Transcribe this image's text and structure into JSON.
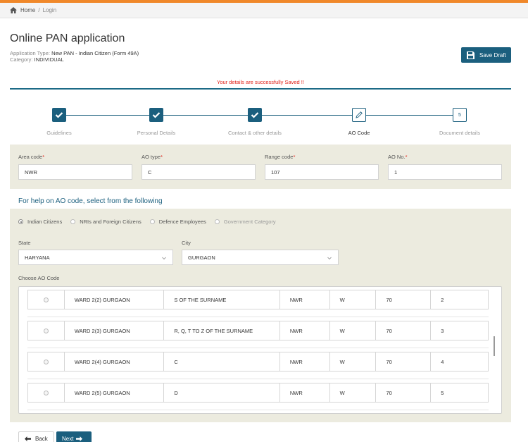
{
  "breadcrumb": {
    "home": "Home",
    "separator": "/",
    "current": "Login"
  },
  "header": {
    "title": "Online PAN application",
    "app_type_label": "Application Type:",
    "app_type_value": "New PAN - Indian Citizen (Form 49A)",
    "category_label": "Category:",
    "category_value": "INDIVIDUAL",
    "save_draft": "Save Draft"
  },
  "message": "Your details are successfully Saved !!",
  "steps": [
    {
      "label": "Guidelines",
      "state": "done"
    },
    {
      "label": "Personal Details",
      "state": "done"
    },
    {
      "label": "Contact & other details",
      "state": "done"
    },
    {
      "label": "AO Code",
      "state": "active"
    },
    {
      "label": "Document details",
      "state": "todo",
      "number": "5"
    }
  ],
  "ao_fields": {
    "area_code": {
      "label": "Area code",
      "value": "NWR"
    },
    "ao_type": {
      "label": "AO type",
      "value": "C"
    },
    "range_code": {
      "label": "Range code",
      "value": "107"
    },
    "ao_no": {
      "label": "AO No.",
      "value": "1"
    },
    "required_mark": "*"
  },
  "help": {
    "title": "For help on AO code, select from the following",
    "options": [
      {
        "label": "Indian Citizens",
        "selected": true
      },
      {
        "label": "NRIs and Foreign Citizens",
        "selected": false
      },
      {
        "label": "Defence Employees",
        "selected": false
      },
      {
        "label": "Government Category",
        "selected": false
      }
    ],
    "state_label": "State",
    "state_value": "HARYANA",
    "city_label": "City",
    "city_value": "GURGAON",
    "choose_label": "Choose AO Code"
  },
  "ao_rows": [
    [
      "WARD 2(2) GURGAON",
      "S OF THE SURNAME",
      "NWR",
      "W",
      "70",
      "2"
    ],
    [
      "WARD 2(3) GURGAON",
      "R, Q, T TO Z OF THE SURNAME",
      "NWR",
      "W",
      "70",
      "3"
    ],
    [
      "WARD 2(4) GURGAON",
      "C",
      "NWR",
      "W",
      "70",
      "4"
    ],
    [
      "WARD 2(5) GURGAON",
      "D",
      "NWR",
      "W",
      "70",
      "5"
    ]
  ],
  "nav": {
    "back": "Back",
    "next": "Next"
  },
  "colors": {
    "accent": "#1b5f7e",
    "top_bar": "#f0882a",
    "panel": "#ecebdf",
    "error": "#e2231a"
  }
}
